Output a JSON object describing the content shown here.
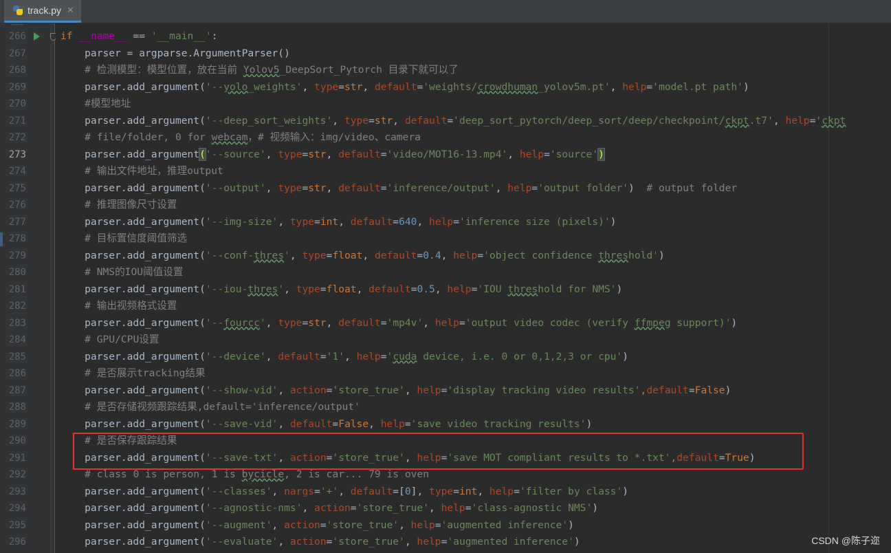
{
  "tab": {
    "filename": "track.py",
    "close_glyph": "✕",
    "icon": "python-file-icon"
  },
  "gutter": {
    "line_numbers": [
      "266",
      "267",
      "268",
      "269",
      "270",
      "271",
      "272",
      "273",
      "274",
      "275",
      "276",
      "277",
      "278",
      "279",
      "280",
      "281",
      "282",
      "283",
      "284",
      "285",
      "286",
      "287",
      "288",
      "289",
      "290",
      "291",
      "292",
      "293",
      "294",
      "295",
      "296"
    ],
    "current_line": "273"
  },
  "code": {
    "lines": [
      "if __name__ == '__main__':",
      "    parser = argparse.ArgumentParser()",
      "    # 检测模型：模型位置，放在当前 Yolov5_DeepSort_Pytorch 目录下就可以了",
      "    parser.add_argument('--yolo_weights', type=str, default='weights/crowdhuman_yolov5m.pt', help='model.pt path')",
      "    #模型地址",
      "    parser.add_argument('--deep_sort_weights', type=str, default='deep_sort_pytorch/deep_sort/deep/checkpoint/ckpt.t7', help='ckpt",
      "    # file/folder, 0 for webcam，# 视频输入：img/video、camera",
      "    parser.add_argument('--source', type=str, default='video/MOT16-13.mp4', help='source')",
      "    # 输出文件地址，推理output",
      "    parser.add_argument('--output', type=str, default='inference/output', help='output folder')  # output folder",
      "    # 推理图像尺寸设置",
      "    parser.add_argument('--img-size', type=int, default=640, help='inference size (pixels)')",
      "    # 目标置信度阈值筛选",
      "    parser.add_argument('--conf-thres', type=float, default=0.4, help='object confidence threshold')",
      "    # NMS的IOU阈值设置",
      "    parser.add_argument('--iou-thres', type=float, default=0.5, help='IOU threshold for NMS')",
      "    # 输出视频格式设置",
      "    parser.add_argument('--fourcc', type=str, default='mp4v', help='output video codec (verify ffmpeg support)')",
      "    # GPU/CPU设置",
      "    parser.add_argument('--device', default='1', help='cuda device, i.e. 0 or 0,1,2,3 or cpu')",
      "    # 是否展示tracking结果",
      "    parser.add_argument('--show-vid', action='store_true', help='display tracking video results',default=False)",
      "    # 是否存储视频跟踪结果,default='inference/output'",
      "    parser.add_argument('--save-vid', default=False, help='save video tracking results')",
      "    # 是否保存跟踪结果",
      "    parser.add_argument('--save-txt', action='store_true', help='save MOT compliant results to *.txt',default=True)",
      "    # class 0 is person, 1 is bycicle, 2 is car... 79 is oven",
      "    parser.add_argument('--classes', nargs='+', default=[0], type=int, help='filter by class')",
      "    parser.add_argument('--agnostic-nms', action='store_true', help='class-agnostic NMS')",
      "    parser.add_argument('--augment', action='store_true', help='augmented inference')",
      "    parser.add_argument('--evaluate', action='store_true', help='augmented inference')"
    ]
  },
  "highlight": {
    "color": "#e5302c",
    "lines": [
      "290",
      "291"
    ]
  },
  "watermark": "CSDN @陈子迩",
  "colors": {
    "background": "#2b2b2b",
    "keyword": "#cc7832",
    "string": "#6a8759",
    "comment": "#808080",
    "number": "#6897bb",
    "kwarg": "#aa4926",
    "dunder": "#b200b2",
    "default_text": "#a9b7c6"
  }
}
